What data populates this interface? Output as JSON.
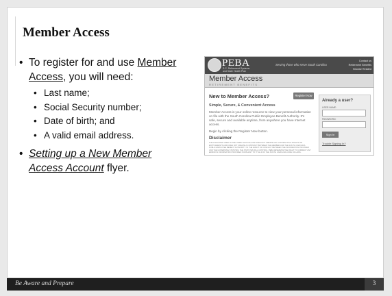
{
  "slide": {
    "title": "Member Access",
    "bullet1": {
      "pre": "To register for and use ",
      "link": "Member Access",
      "post": ", you will need:"
    },
    "requirements": [
      "Last name;",
      "Social Security number;",
      "Date of birth; and",
      "A valid email address."
    ],
    "bullet2": {
      "link": "Setting up a New Member Access Account",
      "post": " flyer."
    }
  },
  "screenshot": {
    "logo_text": "PEBA",
    "logo_sub1": "S.C. Retirement Systems",
    "logo_sub2": "and State Health Plan",
    "tagline": "Serving those who serve South Carolina",
    "header_links": [
      "Contact us",
      "Retirement Benefits",
      "Browse Related"
    ],
    "section_title": "Member Access",
    "section_sub": "RETIREMENT BENEFITS",
    "new_heading": "New to Member Access?",
    "register_button": "Register Now",
    "simple_heading": "Simple, Secure, & Convenient Access",
    "paragraph": "Member Access is your online resource to view your personal information on file with the South Carolina Public Employee Benefit Authority. It's safe, secure and available anytime, from anywhere you have Internet access.",
    "begin_text": "Begin by clicking the Register Now button.",
    "disclaimer_heading": "Disclaimer",
    "disclaimer_text": "The language used in the items that follow does not create any contractual rights or entitlements and does not create a contract between the member and the South Carolina Public Employee Benefit Authority. In the event of conflict between the information provided and the governing statutes, the statutes will control. PEBA reserves the right to correct any error in information provided pursuant to Title 9 of the South Carolina Code of Laws.",
    "login": {
      "heading": "Already a user?",
      "user_label": "USER NAME:",
      "password_label": "PASSWORD:",
      "signin_button": "Sign In",
      "trouble_link": "Trouble Signing In?"
    }
  },
  "footer": {
    "text": "Be Aware and Prepare",
    "page_number": "3"
  }
}
